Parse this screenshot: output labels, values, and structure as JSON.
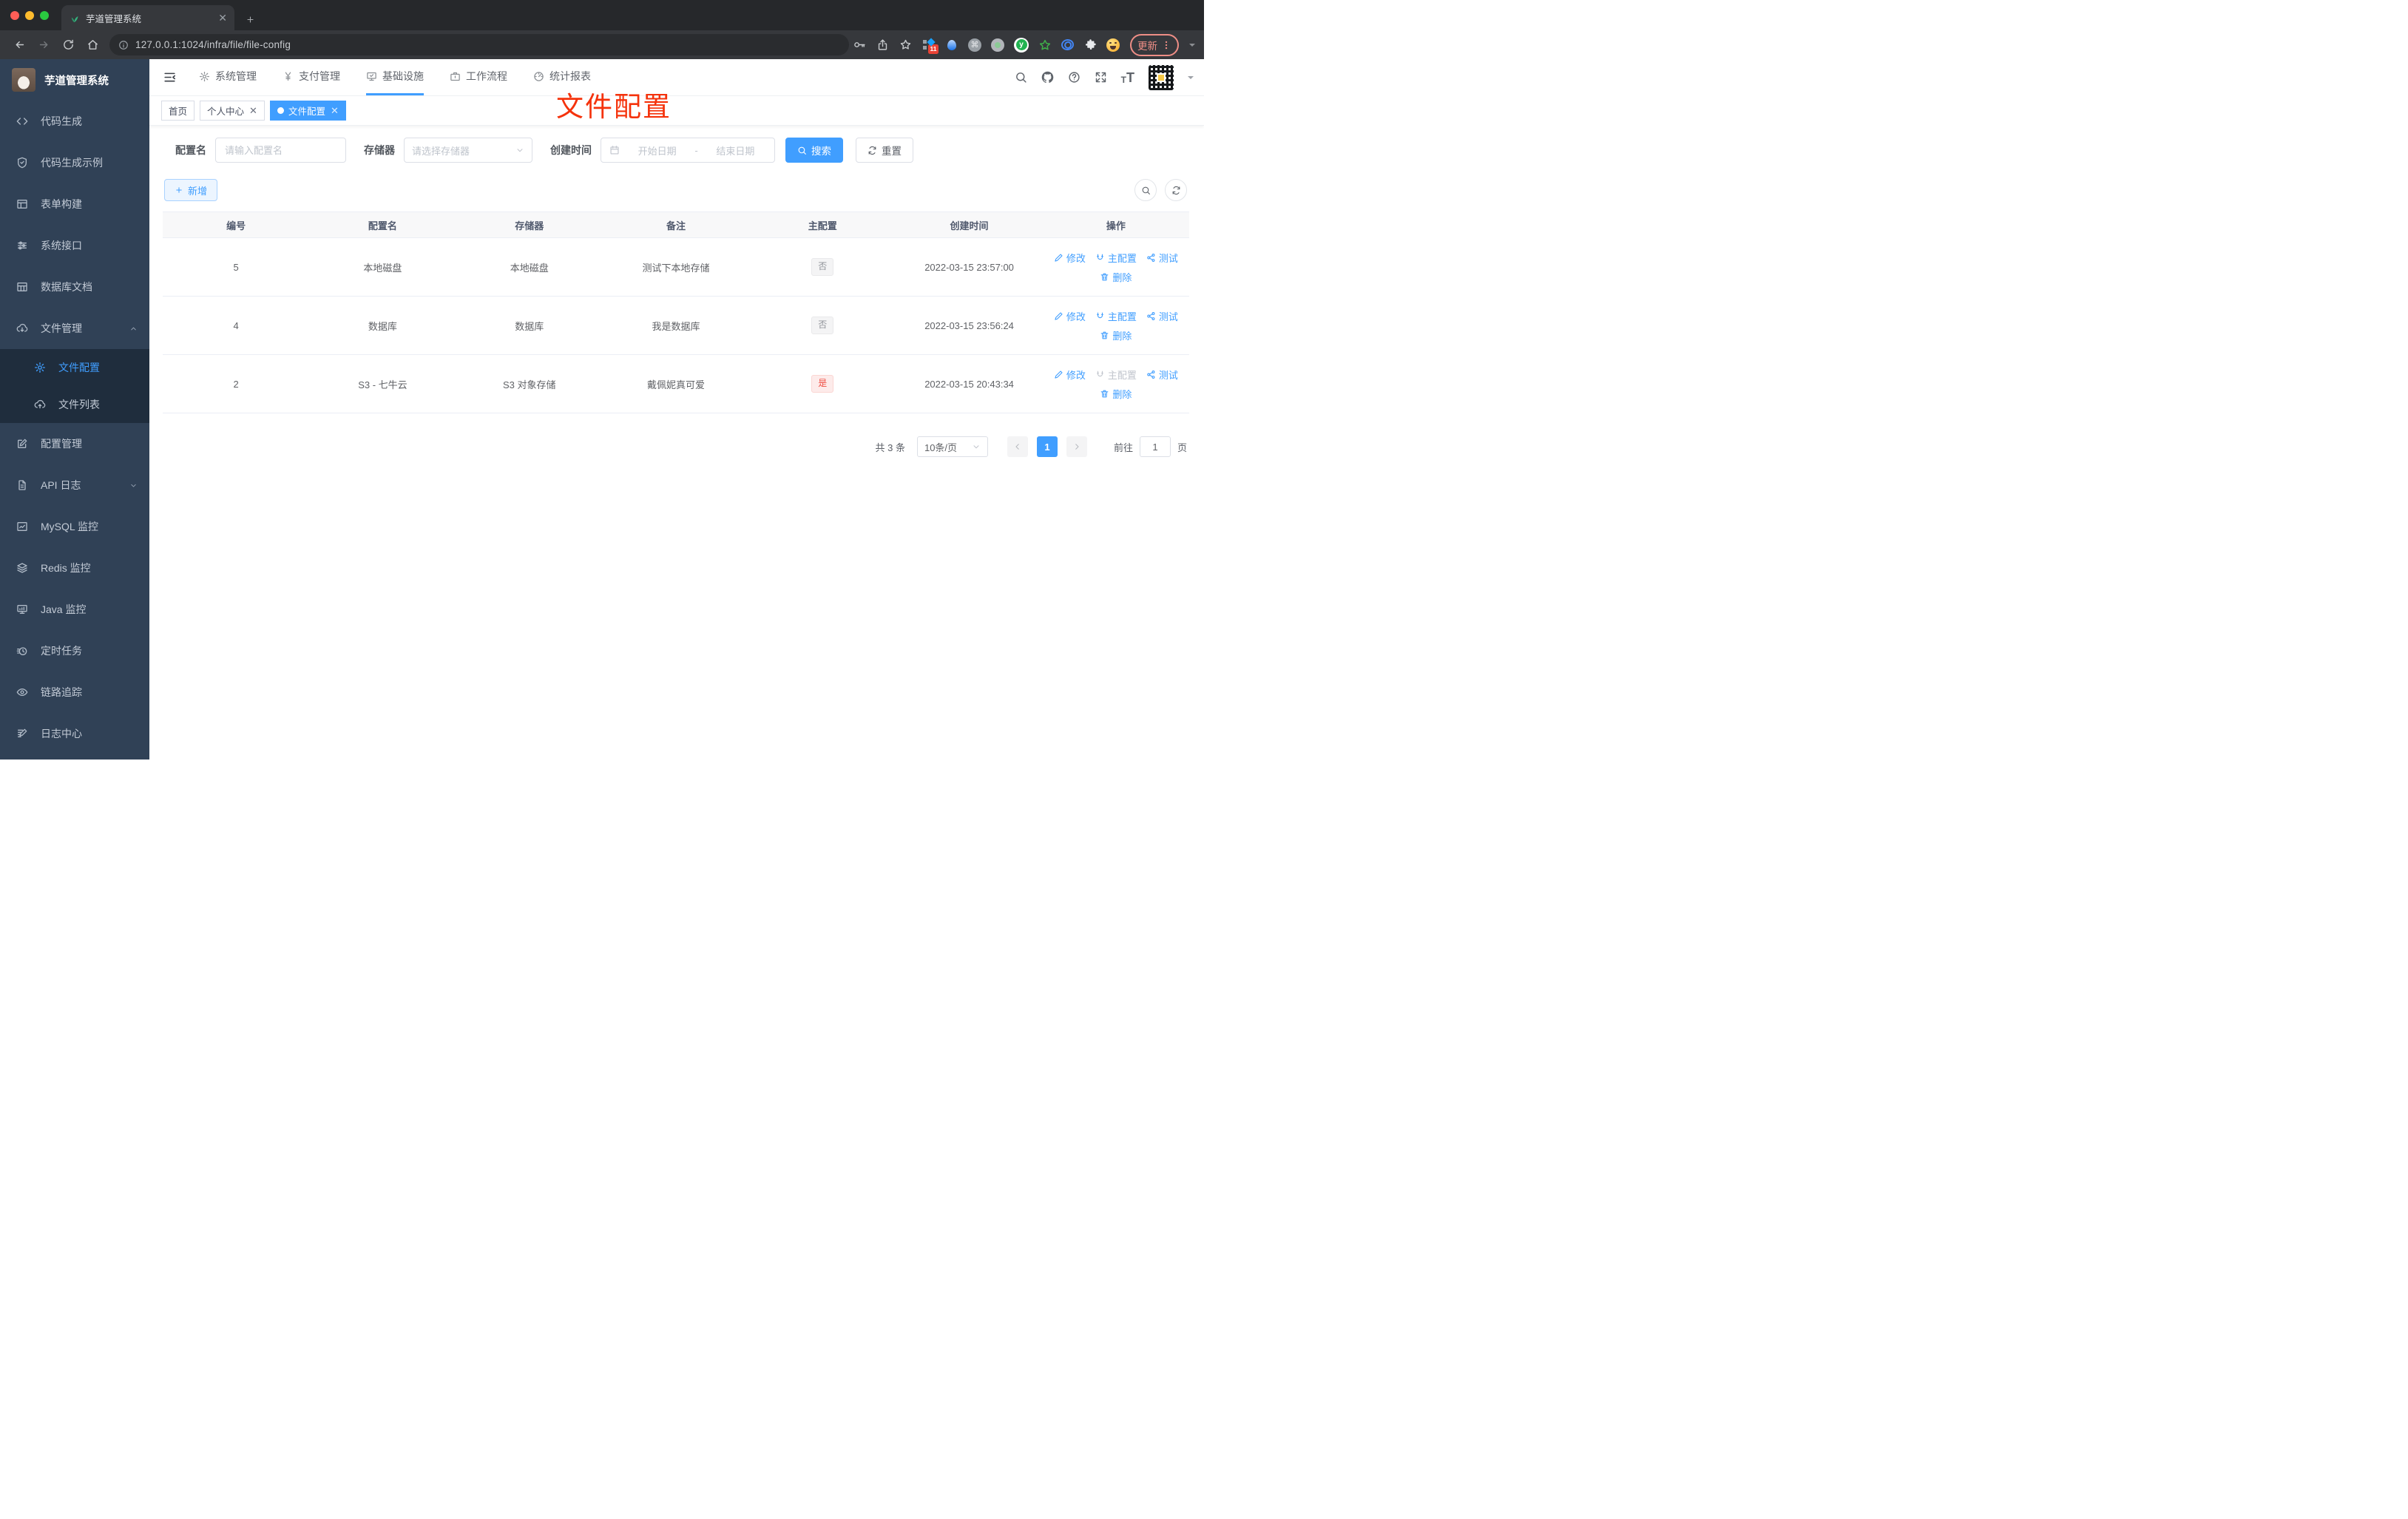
{
  "browser": {
    "tab_title": "芋道管理系统",
    "url": "127.0.0.1:1024/infra/file/file-config",
    "update_label": "更新",
    "extensions": [
      {
        "name": "tab-grid-icon",
        "badge": "11"
      },
      {
        "name": "balloon-icon"
      },
      {
        "name": "command-icon",
        "glyph": "⌘"
      },
      {
        "name": "record-icon"
      },
      {
        "name": "y-circle-icon"
      },
      {
        "name": "star-green-icon"
      },
      {
        "name": "eye-rings-icon"
      },
      {
        "name": "puzzle-icon"
      },
      {
        "name": "emoji-face-icon"
      }
    ]
  },
  "sidebar": {
    "title": "芋道管理系统",
    "items": [
      {
        "label": "代码生成",
        "icon": "code-icon"
      },
      {
        "label": "代码生成示例",
        "icon": "shield-check-icon"
      },
      {
        "label": "表单构建",
        "icon": "form-icon"
      },
      {
        "label": "系统接口",
        "icon": "sliders-icon"
      },
      {
        "label": "数据库文档",
        "icon": "table-grid-icon-side"
      },
      {
        "label": "文件管理",
        "icon": "cloud-download-icon",
        "expanded": true,
        "children": [
          {
            "label": "文件配置",
            "icon": "gear-icon",
            "active": true
          },
          {
            "label": "文件列表",
            "icon": "cloud-upload-icon"
          }
        ]
      },
      {
        "label": "配置管理",
        "icon": "edit-square-icon"
      },
      {
        "label": "API 日志",
        "icon": "doc-edit-icon",
        "collapsible": true
      },
      {
        "label": "MySQL 监控",
        "icon": "chart-icon"
      },
      {
        "label": "Redis 监控",
        "icon": "layers-icon"
      },
      {
        "label": "Java 监控",
        "icon": "monitor-icon"
      },
      {
        "label": "定时任务",
        "icon": "timer-icon"
      },
      {
        "label": "链路追踪",
        "icon": "eye-icon"
      },
      {
        "label": "日志中心",
        "icon": "log-edit-icon"
      }
    ]
  },
  "topnav": {
    "items": [
      {
        "label": "系统管理",
        "icon": "gear-icon"
      },
      {
        "label": "支付管理",
        "icon": "yen-icon"
      },
      {
        "label": "基础设施",
        "icon": "monitor-check-icon",
        "active": true
      },
      {
        "label": "工作流程",
        "icon": "briefcase-icon"
      },
      {
        "label": "统计报表",
        "icon": "gauge-icon"
      }
    ]
  },
  "tabs": [
    {
      "label": "首页"
    },
    {
      "label": "个人中心",
      "closable": true
    },
    {
      "label": "文件配置",
      "closable": true,
      "active": true
    }
  ],
  "annotation": {
    "text": "文件配置",
    "color": "#f5320b"
  },
  "filters": {
    "name_label": "配置名",
    "name_placeholder": "请输入配置名",
    "storage_label": "存储器",
    "storage_placeholder": "请选择存储器",
    "time_label": "创建时间",
    "start_placeholder": "开始日期",
    "separator": "-",
    "end_placeholder": "结束日期",
    "search_label": "搜索",
    "reset_label": "重置"
  },
  "toolbar": {
    "add_label": "新增"
  },
  "table": {
    "columns": [
      "编号",
      "配置名",
      "存储器",
      "备注",
      "主配置",
      "创建时间",
      "操作"
    ],
    "rows": [
      {
        "id": "5",
        "name": "本地磁盘",
        "storage": "本地磁盘",
        "remark": "测试下本地存储",
        "master": "否",
        "master_type": "info",
        "created": "2022-03-15 23:57:00",
        "actions": {
          "edit": "修改",
          "master": "主配置",
          "master_disabled": false,
          "test": "测试",
          "delete": "删除"
        }
      },
      {
        "id": "4",
        "name": "数据库",
        "storage": "数据库",
        "remark": "我是数据库",
        "master": "否",
        "master_type": "info",
        "created": "2022-03-15 23:56:24",
        "actions": {
          "edit": "修改",
          "master": "主配置",
          "master_disabled": false,
          "test": "测试",
          "delete": "删除"
        }
      },
      {
        "id": "2",
        "name": "S3 - 七牛云",
        "storage": "S3 对象存储",
        "remark": "戴佩妮真可爱",
        "master": "是",
        "master_type": "danger",
        "created": "2022-03-15 20:43:34",
        "actions": {
          "edit": "修改",
          "master": "主配置",
          "master_disabled": true,
          "test": "测试",
          "delete": "删除"
        }
      }
    ]
  },
  "pagination": {
    "total": "共 3 条",
    "page_size": "10条/页",
    "current": "1",
    "goto_label": "前往",
    "goto_value": "1",
    "page_unit": "页"
  },
  "colors": {
    "accent": "#409eff",
    "sidebar_bg": "#304156",
    "submenu_bg": "#1f2d3d",
    "danger": "#ef4d41",
    "annotation_red": "#f5320b"
  }
}
